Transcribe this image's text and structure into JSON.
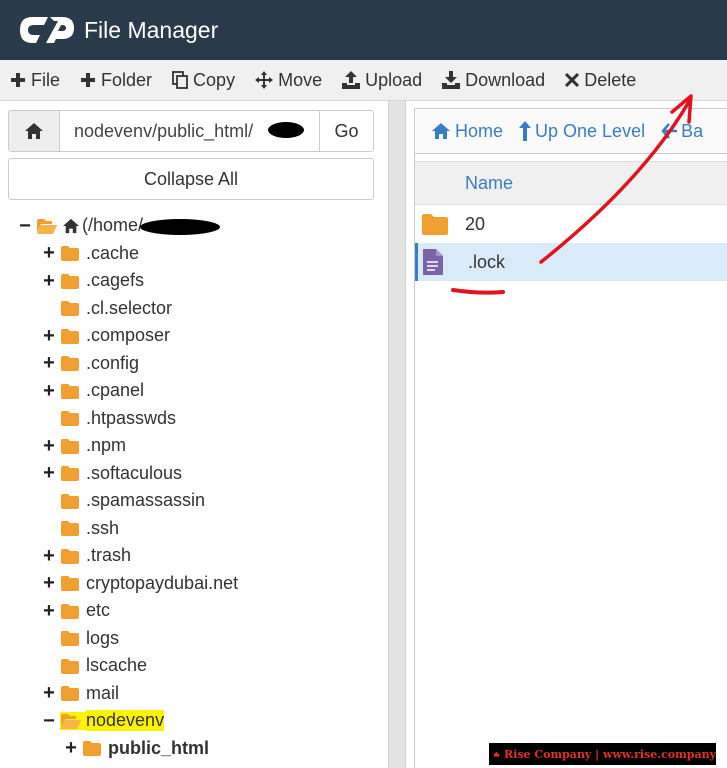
{
  "app": {
    "title": "File Manager",
    "logo": "cpanel-logo"
  },
  "toolbar": {
    "items": [
      {
        "label": "File",
        "icon": "plus-icon"
      },
      {
        "label": "Folder",
        "icon": "plus-icon"
      },
      {
        "label": "Copy",
        "icon": "copy-icon"
      },
      {
        "label": "Move",
        "icon": "move-arrows-icon"
      },
      {
        "label": "Upload",
        "icon": "upload-icon"
      },
      {
        "label": "Download",
        "icon": "download-icon"
      },
      {
        "label": "Delete",
        "icon": "x-icon"
      }
    ]
  },
  "left": {
    "path_value": "nodevenv/public_html/",
    "go_label": "Go",
    "collapse_label": "Collapse All"
  },
  "tree": [
    {
      "label": "(/home/",
      "toggle": "−",
      "open": true,
      "home": true
    },
    {
      "label": ".cache",
      "toggle": "+"
    },
    {
      "label": ".cagefs",
      "toggle": "+"
    },
    {
      "label": ".cl.selector",
      "toggle": ""
    },
    {
      "label": ".composer",
      "toggle": "+"
    },
    {
      "label": ".config",
      "toggle": "+"
    },
    {
      "label": ".cpanel",
      "toggle": "+"
    },
    {
      "label": ".htpasswds",
      "toggle": ""
    },
    {
      "label": ".npm",
      "toggle": "+"
    },
    {
      "label": ".softaculous",
      "toggle": "+"
    },
    {
      "label": ".spamassassin",
      "toggle": ""
    },
    {
      "label": ".ssh",
      "toggle": ""
    },
    {
      "label": ".trash",
      "toggle": "+"
    },
    {
      "label": "cryptopaydubai.net",
      "toggle": "+"
    },
    {
      "label": "etc",
      "toggle": "+"
    },
    {
      "label": "logs",
      "toggle": ""
    },
    {
      "label": "lscache",
      "toggle": ""
    },
    {
      "label": "mail",
      "toggle": "+"
    },
    {
      "label": "nodevenv",
      "toggle": "−",
      "open": true,
      "highlight": true
    },
    {
      "label": "public_html",
      "toggle": "+",
      "bold": true
    }
  ],
  "right": {
    "nav": [
      {
        "label": "Home",
        "icon": "home-icon"
      },
      {
        "label": "Up One Level",
        "icon": "level-up-icon"
      },
      {
        "label": "Ba",
        "icon": "arrow-left-icon"
      }
    ],
    "column_name": "Name",
    "files": [
      {
        "name": "20",
        "type": "folder",
        "selected": false
      },
      {
        "name": ".lock",
        "type": "file",
        "selected": true
      }
    ]
  },
  "watermark": {
    "text": "Rise Company | www.rise.company"
  },
  "colors": {
    "header_bg": "#293a4a",
    "folder": "#f0a030",
    "link": "#3a7dc5",
    "selected_row": "#d9ebf9",
    "highlight": "#fdf300",
    "annotation": "#e0141e"
  }
}
